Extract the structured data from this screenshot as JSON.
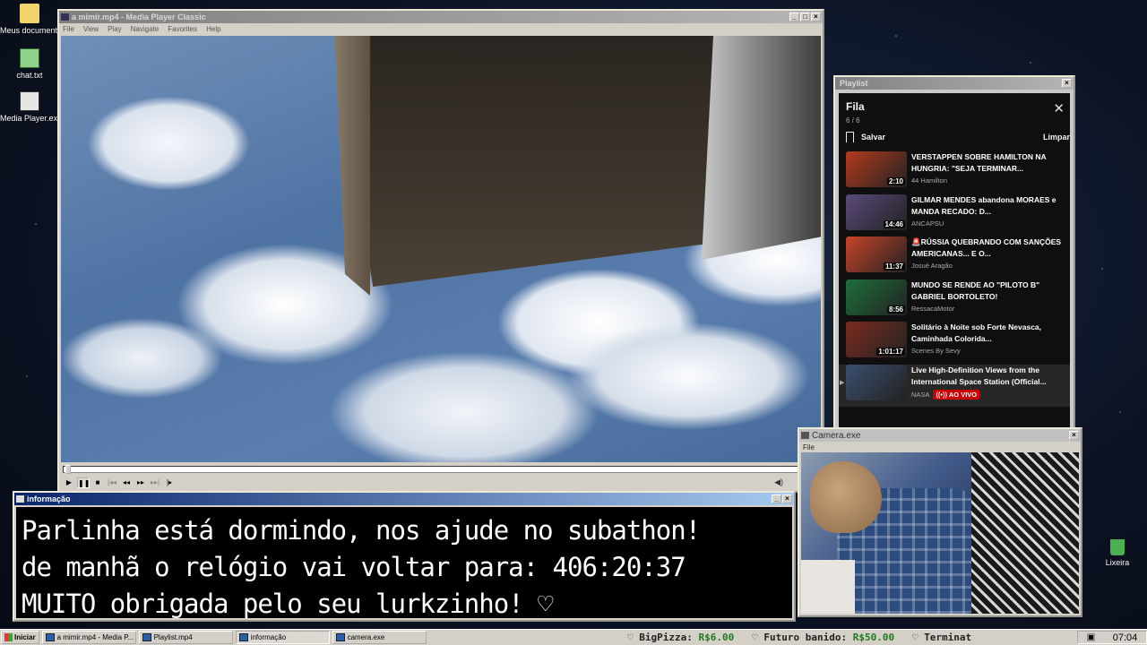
{
  "desktop": {
    "icons": [
      {
        "label": "Meus documentos"
      },
      {
        "label": "chat.txt"
      },
      {
        "label": "Media Player.exe"
      },
      {
        "label": "Lixeira"
      }
    ]
  },
  "mpc": {
    "title": "a mimir.mp4 - Media Player Classic",
    "menu": [
      "File",
      "View",
      "Play",
      "Navigate",
      "Favorites",
      "Help"
    ]
  },
  "playlist": {
    "window_title": "Playlist",
    "title": "Fila",
    "count": "6 / 6",
    "save_label": "Salvar",
    "clear_label": "Limpar",
    "items": [
      {
        "title": "VERSTAPPEN SOBRE HAMILTON NA HUNGRIA: \"SEJA TERMINAR...",
        "channel": "44 Hamilton",
        "duration": "2:10",
        "thumb_color": "#b33a1e",
        "live": ""
      },
      {
        "title": "GILMAR MENDES abandona MORAES e MANDA RECADO: D...",
        "channel": "ANCAPSU",
        "duration": "14:46",
        "thumb_color": "#5a4a7a",
        "live": ""
      },
      {
        "title": "🚨RÚSSIA QUEBRANDO COM SANÇÕES AMERICANAS... E O...",
        "channel": "Josué Aragão",
        "duration": "11:37",
        "thumb_color": "#c8432a",
        "live": ""
      },
      {
        "title": "MUNDO SE RENDE AO \"PILOTO B\" GABRIEL BORTOLETO!",
        "channel": "RessacaMotor",
        "duration": "8:56",
        "thumb_color": "#1d6e3a",
        "live": ""
      },
      {
        "title": "Solitário à Noite sob Forte Nevasca, Caminhada Colorida...",
        "channel": "Scenes By Sevy",
        "duration": "1:01:17",
        "thumb_color": "#7a2a1e",
        "live": ""
      },
      {
        "title": "Live High-Definition Views from the International Space Station (Official...",
        "channel": "NASA",
        "duration": "",
        "thumb_color": "#3b4f6e",
        "live": "AO VIVO"
      }
    ]
  },
  "camera": {
    "title": "Camera.exe",
    "menu": "File"
  },
  "info": {
    "title": "informação",
    "lines": [
      "Parlinha está dormindo, nos ajude no subathon!",
      "de manhã o relógio vai voltar para:  406:20:37",
      "MUITO obrigada pelo seu lurkzinho! ♡"
    ]
  },
  "taskbar": {
    "start": "Iniciar",
    "tasks": [
      "a mimir.mp4 - Media P...",
      "Playlist.mp4",
      "informação",
      "camera.exe"
    ],
    "ticker": [
      {
        "name": "BigPizza:",
        "amount": "R$6.00"
      },
      {
        "name": "Futuro banido:",
        "amount": "R$50.00"
      },
      {
        "name": "Terminat",
        "amount": ""
      }
    ],
    "clock": "07:04"
  }
}
